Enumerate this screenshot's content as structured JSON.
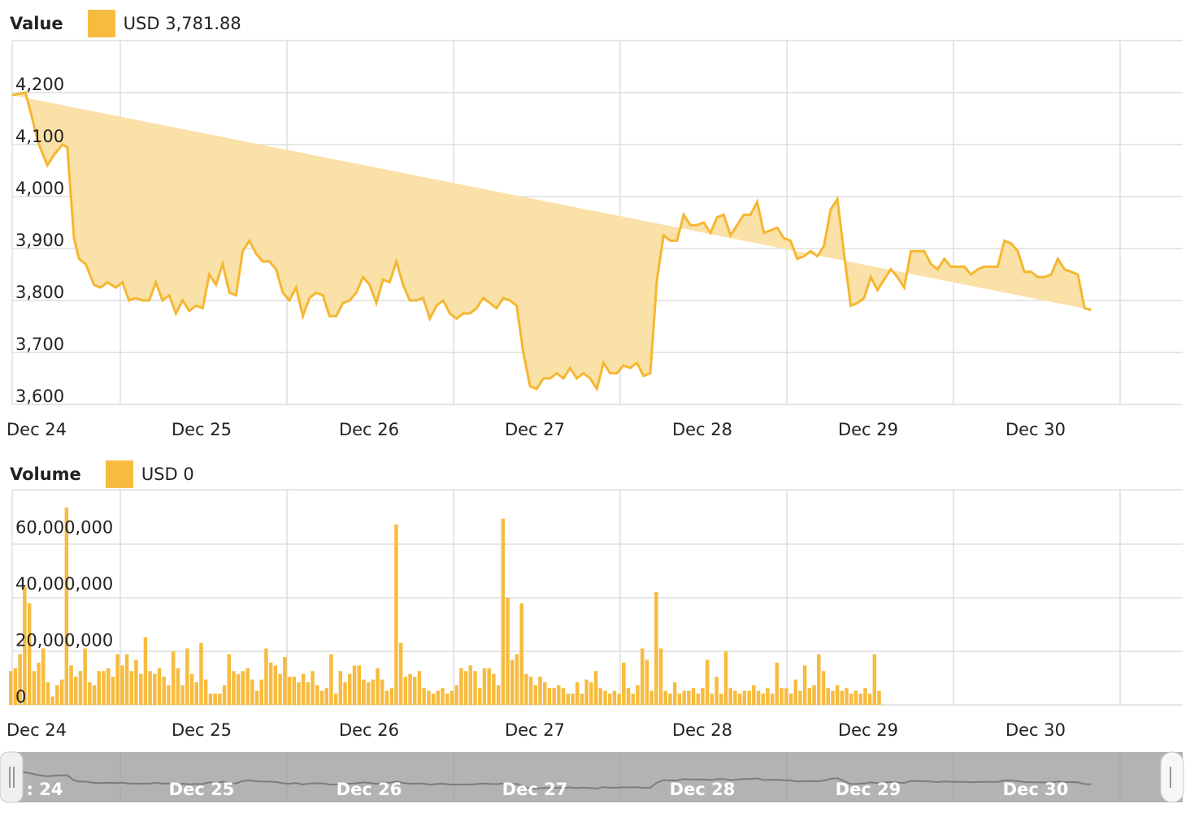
{
  "value_panel": {
    "title": "Value",
    "legend_label": "USD 3,781.88"
  },
  "volume_panel": {
    "title": "Volume",
    "legend_label": "USD 0"
  },
  "colors": {
    "series": "#f7bc3f",
    "line": "#f5b731",
    "area": "#f9e1a8",
    "grid": "#dddddd",
    "navigator": "#b3b3b3"
  },
  "chart_data": [
    {
      "type": "area",
      "title": "Value",
      "currency": "USD",
      "x_tick_labels": [
        "Dec 24",
        "Dec 25",
        "Dec 26",
        "Dec 27",
        "Dec 28",
        "Dec 29",
        "Dec 30"
      ],
      "y_tick_labels": [
        "3,600",
        "3,700",
        "3,800",
        "3,900",
        "4,000",
        "4,100",
        "4,200"
      ],
      "ylim": [
        3600,
        4200
      ],
      "xlim_days": [
        24,
        30.95
      ],
      "grid": true,
      "x": [
        24.0,
        24.08,
        24.16,
        24.21,
        24.25,
        24.3,
        24.33,
        24.37,
        24.4,
        24.44,
        24.49,
        24.53,
        24.57,
        24.62,
        24.66,
        24.7,
        24.74,
        24.78,
        24.82,
        24.86,
        24.9,
        24.94,
        24.98,
        25.02,
        25.06,
        25.1,
        25.14,
        25.18,
        25.22,
        25.26,
        25.3,
        25.34,
        25.38,
        25.42,
        25.46,
        25.5,
        25.54,
        25.58,
        25.62,
        25.66,
        25.7,
        25.74,
        25.78,
        25.82,
        25.86,
        25.9,
        25.94,
        25.98,
        26.02,
        26.06,
        26.1,
        26.14,
        26.18,
        26.22,
        26.26,
        26.3,
        26.34,
        26.38,
        26.42,
        26.46,
        26.5,
        26.54,
        26.58,
        26.62,
        26.66,
        26.7,
        26.74,
        26.78,
        26.82,
        26.86,
        26.9,
        26.94,
        26.98,
        27.02,
        27.06,
        27.1,
        27.14,
        27.18,
        27.22,
        27.26,
        27.3,
        27.34,
        27.38,
        27.42,
        27.46,
        27.5,
        27.54,
        27.58,
        27.62,
        27.66,
        27.7,
        27.74,
        27.78,
        27.82,
        27.86,
        27.9,
        27.94,
        27.98,
        28.02,
        28.06,
        28.1,
        28.14,
        28.18,
        28.22,
        28.26,
        28.3,
        28.34,
        28.38,
        28.42,
        28.46,
        28.5,
        28.54,
        28.58,
        28.62,
        28.66,
        28.7,
        28.74,
        28.78,
        28.82,
        28.86,
        28.9,
        28.94,
        28.98,
        29.02,
        29.06,
        29.1,
        29.14,
        29.18,
        29.22,
        29.26,
        29.3,
        29.34,
        29.38,
        29.42,
        29.46,
        29.5,
        29.54,
        29.58,
        29.62,
        29.66,
        29.7,
        29.74,
        29.78,
        29.82,
        29.86,
        29.9,
        29.94,
        29.98,
        30.02,
        30.06,
        30.1,
        30.14,
        30.18,
        30.22,
        30.26,
        30.3,
        30.34,
        30.38,
        30.42,
        30.46,
        30.5,
        30.54,
        30.58,
        30.62,
        30.66,
        30.7,
        30.74,
        30.78,
        30.82,
        30.86,
        30.9,
        30.95
      ],
      "y": [
        4195,
        4200,
        4100,
        4060,
        4080,
        4100,
        4095,
        3920,
        3880,
        3870,
        3830,
        3825,
        3835,
        3825,
        3835,
        3800,
        3805,
        3800,
        3800,
        3835,
        3800,
        3810,
        3775,
        3800,
        3780,
        3790,
        3785,
        3850,
        3830,
        3870,
        3815,
        3810,
        3895,
        3915,
        3890,
        3875,
        3875,
        3860,
        3815,
        3800,
        3825,
        3770,
        3805,
        3815,
        3810,
        3770,
        3770,
        3795,
        3800,
        3815,
        3845,
        3830,
        3795,
        3840,
        3835,
        3875,
        3830,
        3800,
        3800,
        3805,
        3765,
        3790,
        3800,
        3775,
        3765,
        3775,
        3775,
        3785,
        3805,
        3795,
        3785,
        3805,
        3800,
        3790,
        3700,
        3635,
        3630,
        3650,
        3650,
        3660,
        3650,
        3670,
        3650,
        3660,
        3650,
        3630,
        3680,
        3660,
        3660,
        3675,
        3670,
        3680,
        3655,
        3660,
        3840,
        3925,
        3915,
        3915,
        3965,
        3945,
        3945,
        3950,
        3930,
        3960,
        3965,
        3925,
        3945,
        3965,
        3965,
        3990,
        3930,
        3935,
        3940,
        3920,
        3915,
        3880,
        3885,
        3895,
        3885,
        3905,
        3975,
        3995,
        3890,
        3790,
        3795,
        3805,
        3845,
        3820,
        3840,
        3860,
        3845,
        3825,
        3895,
        3895,
        3895,
        3870,
        3860,
        3880,
        3865,
        3865,
        3865,
        3850,
        3860,
        3865,
        3865,
        3865,
        3915,
        3910,
        3895,
        3855,
        3855,
        3845,
        3845,
        3850,
        3880,
        3860,
        3855,
        3850,
        3785,
        3782
      ]
    },
    {
      "type": "bar",
      "title": "Volume",
      "currency": "USD",
      "x_tick_labels": [
        "Dec 24",
        "Dec 25",
        "Dec 26",
        "Dec 27",
        "Dec 28",
        "Dec 29",
        "Dec 30"
      ],
      "y_tick_labels": [
        "0",
        "20,000,000",
        "40,000,000",
        "60,000,000"
      ],
      "ylim": [
        0,
        76000000
      ],
      "grid": true,
      "x_start_day": 24.0,
      "bar_interval_days": 0.0278,
      "values": [
        12,
        13,
        18,
        42,
        36,
        12,
        15,
        20,
        8,
        3,
        7,
        9,
        70,
        14,
        10,
        12,
        20,
        8,
        7,
        12,
        12,
        13,
        10,
        18,
        14,
        18,
        12,
        16,
        11,
        24,
        12,
        11,
        13,
        10,
        7,
        19,
        13,
        7,
        20,
        11,
        8,
        22,
        9,
        4,
        4,
        4,
        7,
        18,
        12,
        11,
        12,
        13,
        9,
        5,
        9,
        20,
        15,
        14,
        11,
        17,
        10,
        10,
        8,
        11,
        8,
        12,
        7,
        5,
        6,
        18,
        4,
        12,
        8,
        11,
        14,
        14,
        9,
        8,
        9,
        13,
        9,
        5,
        6,
        64,
        22,
        10,
        11,
        10,
        12,
        6,
        5,
        4,
        5,
        6,
        4,
        5,
        7,
        13,
        12,
        14,
        12,
        6,
        13,
        13,
        11,
        7,
        66,
        38,
        16,
        18,
        36,
        11,
        10,
        7,
        10,
        8,
        6,
        6,
        7,
        6,
        4,
        4,
        8,
        4,
        9,
        8,
        12,
        6,
        5,
        4,
        5,
        4,
        15,
        6,
        4,
        7,
        20,
        16,
        5,
        40,
        20,
        5,
        4,
        8,
        4,
        5,
        5,
        6,
        4,
        6,
        16,
        4,
        10,
        4,
        19,
        6,
        5,
        4,
        5,
        5,
        7,
        5,
        4,
        6,
        4,
        15,
        6,
        6,
        4,
        9,
        5,
        14,
        6,
        7,
        18,
        12,
        6,
        5,
        7,
        5,
        6,
        4,
        5,
        4,
        6,
        4,
        18,
        5
      ]
    }
  ],
  "navigator": {
    "labels": [
      ": 24",
      "Dec 25",
      "Dec 26",
      "Dec 27",
      "Dec 28",
      "Dec 29",
      "Dec 30"
    ]
  }
}
